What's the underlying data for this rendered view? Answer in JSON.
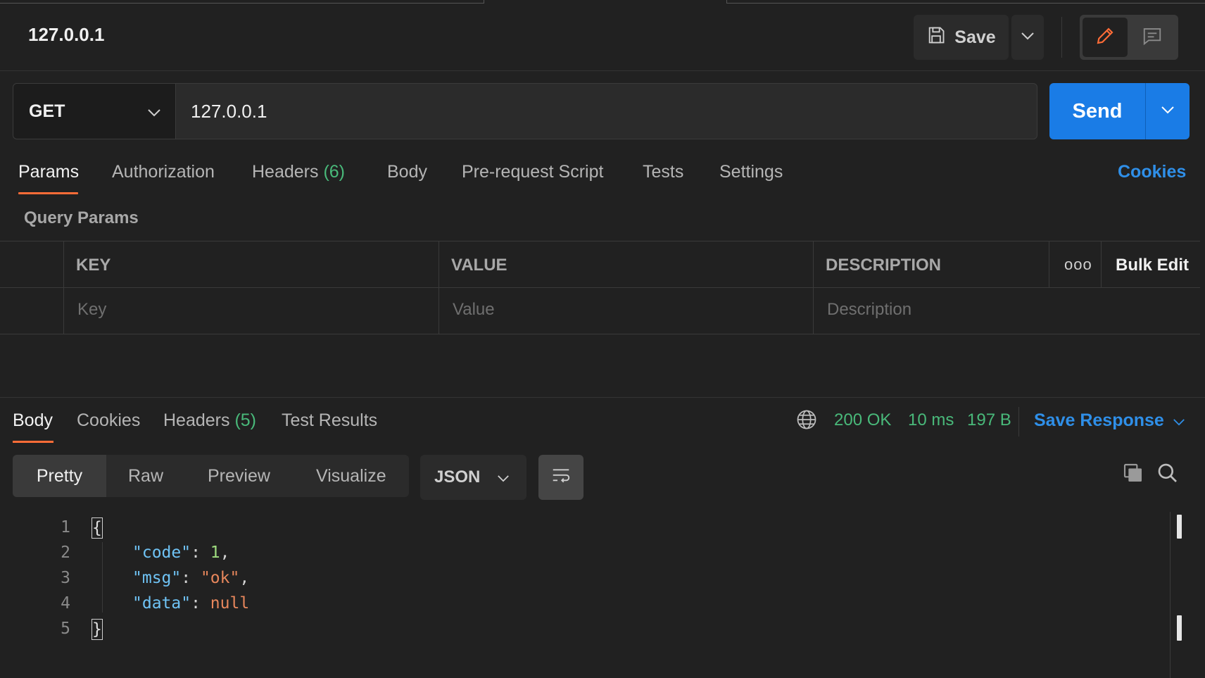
{
  "request": {
    "title": "127.0.0.1",
    "save_label": "Save",
    "method": "GET",
    "url": "127.0.0.1",
    "send_label": "Send"
  },
  "request_tabs": [
    {
      "label": "Params",
      "count": ""
    },
    {
      "label": "Authorization",
      "count": ""
    },
    {
      "label": "Headers",
      "count": "(6)"
    },
    {
      "label": "Body",
      "count": ""
    },
    {
      "label": "Pre-request Script",
      "count": ""
    },
    {
      "label": "Tests",
      "count": ""
    },
    {
      "label": "Settings",
      "count": ""
    }
  ],
  "cookies_link": "Cookies",
  "query_params": {
    "section_label": "Query Params",
    "columns": [
      "KEY",
      "VALUE",
      "DESCRIPTION"
    ],
    "bulk_edit_label": "Bulk Edit",
    "more_label": "ooo",
    "placeholders": {
      "key": "Key",
      "value": "Value",
      "description": "Description"
    }
  },
  "response": {
    "tabs": [
      {
        "label": "Body",
        "count": ""
      },
      {
        "label": "Cookies",
        "count": ""
      },
      {
        "label": "Headers",
        "count": "(5)"
      },
      {
        "label": "Test Results",
        "count": ""
      }
    ],
    "status": "200 OK",
    "time": "10 ms",
    "size": "197 B",
    "save_response_label": "Save Response",
    "view_modes": [
      "Pretty",
      "Raw",
      "Preview",
      "Visualize"
    ],
    "format": "JSON",
    "code_lines": [
      {
        "num": "1",
        "text": "{"
      },
      {
        "num": "2",
        "key": "\"code\"",
        "value": "1"
      },
      {
        "num": "3",
        "key": "\"msg\"",
        "value": "\"ok\""
      },
      {
        "num": "4",
        "key": "\"data\"",
        "value": "null"
      },
      {
        "num": "5",
        "text": "}"
      }
    ]
  },
  "colors": {
    "accent_orange": "#ff6c37",
    "send_blue": "#1a7ce6",
    "link_blue": "#2f8fe8",
    "status_green": "#49b97a",
    "background": "#212121"
  },
  "icons": [
    "save-icon",
    "chevron-down-icon",
    "pencil-icon",
    "comment-icon",
    "globe-icon",
    "wrap-lines-icon",
    "copy-icon",
    "search-icon"
  ]
}
